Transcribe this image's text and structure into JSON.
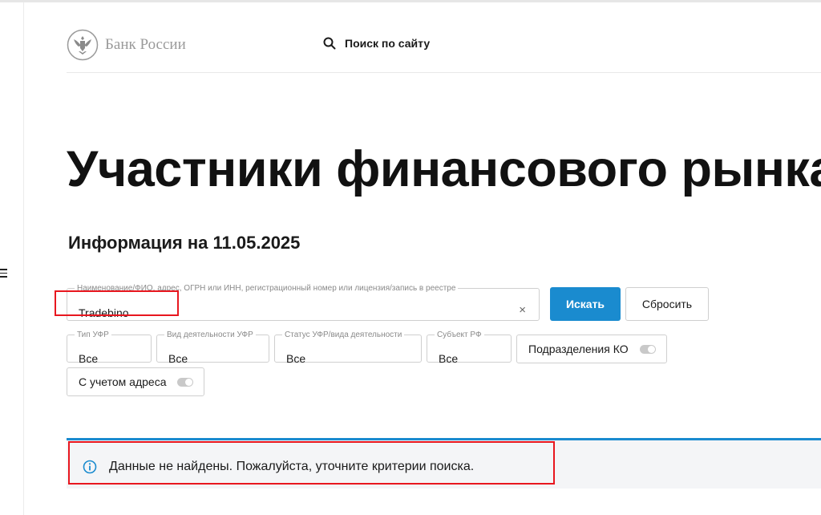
{
  "header": {
    "logo_text": "Банк России",
    "search_label": "Поиск по сайту"
  },
  "page": {
    "title": "Участники финансового рынка",
    "subtitle": "Информация на 11.05.2025"
  },
  "search_form": {
    "main_field_legend": "Наименование/ФИО, адрес, ОГРН или ИНН, регистрационный номер или лицензия/запись в реестре",
    "main_field_value": "Tradebino",
    "clear_symbol": "×",
    "search_button": "Искать",
    "reset_button": "Сбросить",
    "filters": [
      {
        "legend": "Тип УФР",
        "value": "Все"
      },
      {
        "legend": "Вид деятельности УФР",
        "value": "Все"
      },
      {
        "legend": "Статус УФР/вида деятельности",
        "value": "Все"
      },
      {
        "legend": "Субъект РФ",
        "value": "Все"
      }
    ],
    "toggles": [
      {
        "label": "Подразделения КО",
        "on": false
      },
      {
        "label": "С учетом адреса",
        "on": false
      }
    ]
  },
  "alert": {
    "message": "Данные не найдены. Пожалуйста, уточните критерии поиска."
  },
  "colors": {
    "accent": "#1a8bcf",
    "highlight": "#e8171f",
    "alert_bg": "#f4f5f7",
    "logo_gray": "#9a9a9a"
  },
  "icons": {
    "logo": "double-headed-eagle-emblem",
    "search": "magnifier-icon",
    "alert": "info-circle-icon",
    "menu": "hamburger-menu-icon"
  }
}
